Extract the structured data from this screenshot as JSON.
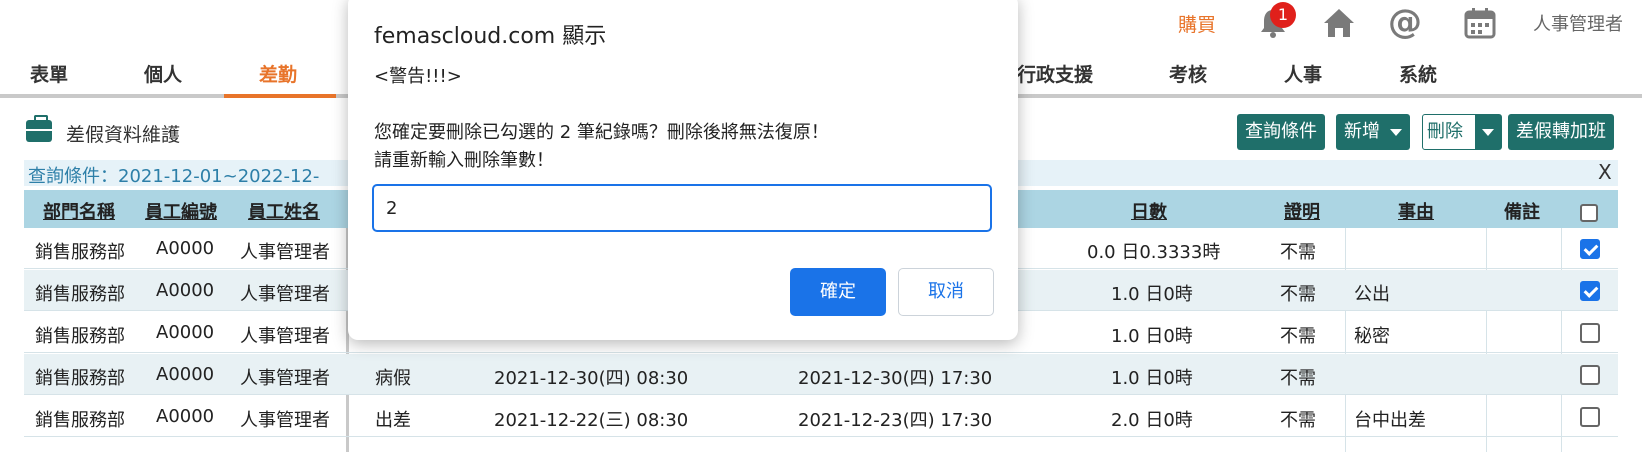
{
  "topbar": {
    "buy_label": "購買",
    "notification_count": "1",
    "user_name": "人事管理者"
  },
  "nav": {
    "items": [
      "表單",
      "個人",
      "差勤",
      "行政支援",
      "考核",
      "人事",
      "系統"
    ],
    "active": "差勤"
  },
  "page": {
    "title": "差假資料維護",
    "buttons": {
      "query": "查詢條件",
      "add": "新增",
      "delete": "刪除",
      "convert": "差假轉加班"
    },
    "query_text": "查詢條件：2021-12-01~2022-12-",
    "close": "X"
  },
  "table": {
    "headers": {
      "dept": "部門名稱",
      "emp_no": "員工編號",
      "emp_name": "員工姓名",
      "days": "日數",
      "proof": "證明",
      "reason": "事由",
      "note": "備註"
    },
    "rows": [
      {
        "dept": "銷售服務部",
        "emp_no": "A0000",
        "emp_name": "人事管理者",
        "type": "",
        "start": "",
        "end": "",
        "days": "0.0 日0.3333時",
        "proof": "不需",
        "reason": "",
        "checked": true
      },
      {
        "dept": "銷售服務部",
        "emp_no": "A0000",
        "emp_name": "人事管理者",
        "type": "",
        "start": "",
        "end": "",
        "days": "1.0 日0時",
        "proof": "不需",
        "reason": "公出",
        "checked": true
      },
      {
        "dept": "銷售服務部",
        "emp_no": "A0000",
        "emp_name": "人事管理者",
        "type": "",
        "start": "",
        "end": "",
        "days": "1.0 日0時",
        "proof": "不需",
        "reason": "秘密",
        "checked": false
      },
      {
        "dept": "銷售服務部",
        "emp_no": "A0000",
        "emp_name": "人事管理者",
        "type": "病假",
        "start": "2021-12-30(四) 08:30",
        "end": "2021-12-30(四) 17:30",
        "days": "1.0 日0時",
        "proof": "不需",
        "reason": "",
        "checked": false
      },
      {
        "dept": "銷售服務部",
        "emp_no": "A0000",
        "emp_name": "人事管理者",
        "type": "出差",
        "start": "2021-12-22(三) 08:30",
        "end": "2021-12-23(四) 17:30",
        "days": "2.0 日0時",
        "proof": "不需",
        "reason": "台中出差",
        "checked": false
      }
    ]
  },
  "dialog": {
    "title": "femascloud.com 顯示",
    "subtitle": "<警告!!!>",
    "message_line1": "您確定要刪除已勾選的 2 筆紀錄嗎？刪除後將無法復原！",
    "message_line2": "請重新輸入刪除筆數！",
    "input_value": "2",
    "ok_label": "確定",
    "cancel_label": "取消"
  },
  "colors": {
    "accent_orange": "#e8742a",
    "teal": "#1f6f6a",
    "blue": "#1a73e8",
    "header_bg": "#acd5e3"
  }
}
